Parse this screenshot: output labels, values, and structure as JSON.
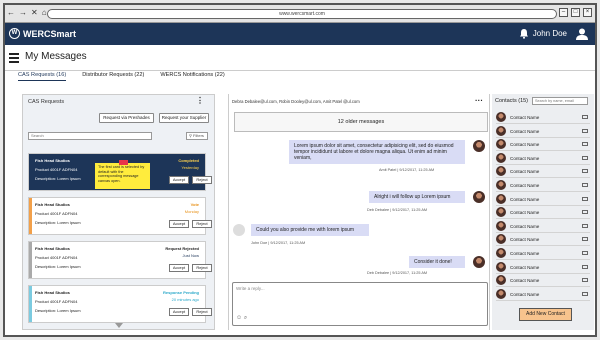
{
  "browser": {
    "url": "www.wercsmart.com",
    "nav": [
      "←",
      "→",
      "✕",
      "⌂"
    ]
  },
  "app": {
    "brand": "WERCSmart",
    "user_name": "John Doe"
  },
  "page": {
    "title": "My Messages"
  },
  "tabs": [
    {
      "label": "CAS Requests (16)",
      "active": true
    },
    {
      "label": "Distributor Requests (22)",
      "active": false
    },
    {
      "label": "WERCS Notifications (22)",
      "active": false
    }
  ],
  "cas_panel": {
    "title": "CAS Requests",
    "btn_preshades": "Request via Preshades",
    "btn_supplier": "Request your Supplier",
    "search_placeholder": "Search",
    "filter_label": "Filters",
    "cards": [
      {
        "name": "Fish Head Studios",
        "product": "Product 4001F   ADFN04",
        "desc": "Description: Lorem Ipsum",
        "status": "Completed",
        "when": "Yesterday",
        "accept": "Accept",
        "reject": "Reject",
        "status_color": "#ffd24d",
        "stripe": "#1d3558"
      },
      {
        "name": "Fish Head Studios",
        "product": "Product 4001F   ADFN04",
        "desc": "Description: Lorem Ipsum",
        "status": "Vote",
        "when": "Monday",
        "accept": "Accept",
        "reject": "Reject",
        "status_color": "#e8921a",
        "stripe": "#f2a04a"
      },
      {
        "name": "Fish Head Studios",
        "product": "Product 4001F   ADFN04",
        "desc": "Description: Lorem Ipsum",
        "status": "Request Rejected",
        "when": "Just Now",
        "accept": "Accept",
        "reject": "Reject",
        "status_color": "#222222",
        "stripe": "#aaaaaa"
      },
      {
        "name": "Fish Head Studios",
        "product": "Product 4001F   ADFN04",
        "desc": "Description: Lorem Ipsum",
        "status": "Response Pending",
        "when": "20 minutes ago",
        "accept": "Accept",
        "reject": "Reject",
        "status_color": "#2aa8c9",
        "stripe": "#7ccbe0"
      }
    ],
    "sticky_note": "The first card is selected by default with the corresponding message canvas open."
  },
  "chat": {
    "recipients": "Debra Debalee@ul.com, Robin Dooley@ul.com, Amit Patel @ul.com",
    "older_label": "12 older messages",
    "messages": [
      {
        "text": "Lorem ipsum dolor sit amet, consectetur adipisicing elit, sed do eiusmod tempor incididunt ut labore et dolore magna aliqua. Ut enim ad minim veniam,",
        "meta": "Amit Patel | 9/12/2017, 11:25 AM",
        "side": "right"
      },
      {
        "text": "Alright i will follow up Lorem ipsum",
        "meta": "Deb Debalee | 9/12/2017, 11:25 AM",
        "side": "right"
      },
      {
        "text": "Could you also provide me with lorem ipsum",
        "meta": "John Doe | 9/12/2017, 11:25 AM",
        "side": "left"
      },
      {
        "text": "Consider it done!",
        "meta": "Deb Debalee | 9/12/2017, 11:25 AM",
        "side": "right"
      }
    ],
    "reply_placeholder": "Write a reply..."
  },
  "contacts": {
    "title": "Contacts (15)",
    "search_placeholder": "Search by name, email",
    "items": [
      "Contact Name",
      "Contact Name",
      "Contact Name",
      "Contact Name",
      "Contact Name",
      "Contact Name",
      "Contact Name",
      "Contact Name",
      "Contact Name",
      "Contact Name",
      "Contact Name",
      "Contact Name",
      "Contact Name",
      "Contact Name"
    ],
    "add_label": "Add New Contact"
  }
}
